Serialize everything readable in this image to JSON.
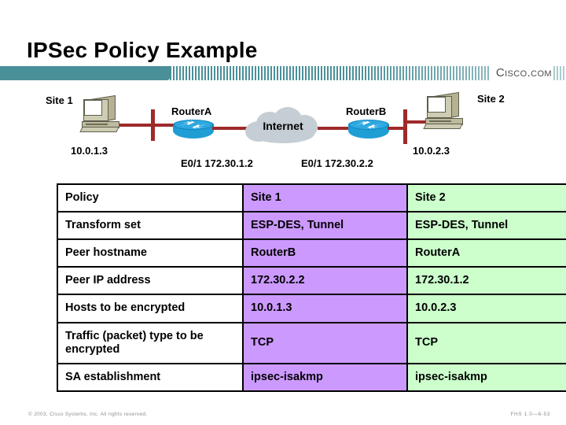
{
  "slide": {
    "title": "IPSec Policy Example",
    "brand": "Cisco.com"
  },
  "diagram": {
    "site1_label": "Site 1",
    "site2_label": "Site 2",
    "host1_ip": "10.0.1.3",
    "host2_ip": "10.0.2.3",
    "router_a": "RouterA",
    "router_b": "RouterB",
    "router_a_interface": "E0/1 172.30.1.2",
    "router_b_interface": "E0/1 172.30.2.2",
    "cloud_label": "Internet",
    "colors": {
      "wire": "#9e2a2a",
      "router": "#1f9ed6",
      "cloud": "#c5ced4",
      "pc": "#cfccb4"
    }
  },
  "table": {
    "columns": [
      "Policy",
      "Site 1",
      "Site 2"
    ],
    "rows": [
      {
        "label": "Policy",
        "site1": "Site 1",
        "site2": "Site 2"
      },
      {
        "label": "Transform set",
        "site1": "ESP-DES, Tunnel",
        "site2": "ESP-DES, Tunnel"
      },
      {
        "label": "Peer hostname",
        "site1": "RouterB",
        "site2": "RouterA"
      },
      {
        "label": "Peer IP address",
        "site1": "172.30.2.2",
        "site2": "172.30.1.2"
      },
      {
        "label": "Hosts to be encrypted",
        "site1": "10.0.1.3",
        "site2": "10.0.2.3"
      },
      {
        "label": "Traffic (packet) type to be encrypted",
        "site1": "TCP",
        "site2": "TCP"
      },
      {
        "label": "SA establishment",
        "site1": "ipsec-isakmp",
        "site2": "ipsec-isakmp"
      }
    ],
    "colors": {
      "site1_bg": "#cc99ff",
      "site2_bg": "#ccffcc",
      "label_bg": "#ffffff",
      "border": "#000000"
    }
  },
  "footer": {
    "copyright": "© 2003, Cisco Systems, Inc. All rights reserved.",
    "code": "FHS 1.0—6-53"
  },
  "theme": {
    "banner": "#4a9099"
  }
}
